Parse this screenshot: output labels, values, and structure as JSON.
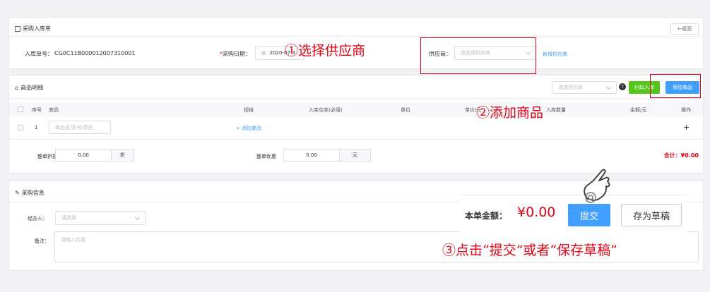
{
  "header": {
    "title": "采购入库单",
    "back_label": "←返回",
    "order_no_label": "入库单号：",
    "order_no_value": "CG0C11B000012007310001",
    "date_label": "采购日期：",
    "date_value": "2020-07-3",
    "supplier_label": "供应商：",
    "supplier_placeholder": "请选择供应商",
    "add_supplier_link": "新增供应商"
  },
  "goods": {
    "title": "商品明细",
    "warehouse_placeholder": "请选择仓库",
    "scan_label": "扫码入库",
    "add_goods_label": "添加商品",
    "columns": [
      "序号",
      "商品",
      "规格",
      "入库仓库(必填)",
      "单位",
      "单价/元",
      "入库数量",
      "金额/元",
      "操作"
    ],
    "row": {
      "index": "1",
      "goods_placeholder": "商品名/货号/条形",
      "add_goods_link": "+ 添加商品",
      "op_plus": "+"
    },
    "discount_label": "整单折扣",
    "discount_value": "0.00",
    "discount_unit": "折",
    "offer_label": "整单优惠",
    "offer_value": "0.00",
    "offer_unit": "元",
    "total": "合计：¥0.00"
  },
  "purchase_info": {
    "title": "采购信息",
    "handler_label": "经办人：",
    "handler_placeholder": "请选择",
    "remark_label": "备注：",
    "remark_placeholder": "请输入内容"
  },
  "footer": {
    "amount_label": "本单金额：",
    "amount_value": "¥0.00",
    "submit_label": "提交",
    "draft_label": "存为草稿"
  },
  "annotations": {
    "step1": "①选择供应商",
    "step2": "②添加商品",
    "step3": "③点击“提交”或者“保存草稿”"
  },
  "colors": {
    "accent": "#409eff",
    "green": "#52c41a",
    "annotation_red": "#e60012"
  }
}
